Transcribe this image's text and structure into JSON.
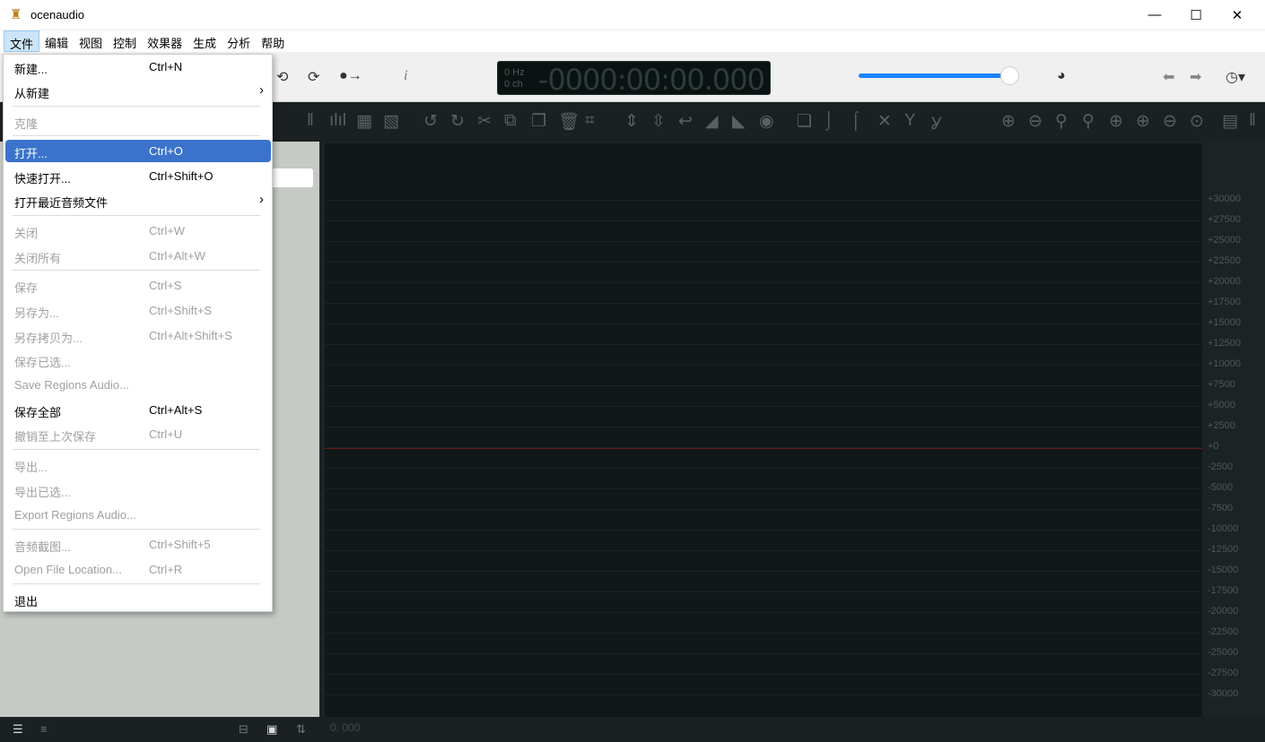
{
  "app": {
    "title": "ocenaudio",
    "icon": "ocenaudio-logo-icon"
  },
  "window_controls": [
    "minimize",
    "maximize",
    "close"
  ],
  "menubar": [
    "文件",
    "编辑",
    "视图",
    "控制",
    "效果器",
    "生成",
    "分析",
    "帮助"
  ],
  "display": {
    "rate": "0 Hz",
    "channels": "0 ch",
    "time": "-0000:00:00.000"
  },
  "volume": {
    "level_percent": 100,
    "color": "#1a84ff"
  },
  "file_menu": [
    {
      "label": "新建...",
      "shortcut": "Ctrl+N",
      "disabled": false
    },
    {
      "label": "从新建",
      "shortcut": "",
      "submenu": true,
      "disabled": false
    },
    {
      "label": "克隆",
      "shortcut": "",
      "disabled": true,
      "sep": true
    },
    {
      "label": "打开...",
      "shortcut": "Ctrl+O",
      "disabled": false,
      "highlighted": true,
      "sep": true
    },
    {
      "label": "快速打开...",
      "shortcut": "Ctrl+Shift+O",
      "disabled": false
    },
    {
      "label": "打开最近音频文件",
      "shortcut": "",
      "submenu": true,
      "disabled": false
    },
    {
      "label": "关闭",
      "shortcut": "Ctrl+W",
      "disabled": true,
      "sep": true
    },
    {
      "label": "关闭所有",
      "shortcut": "Ctrl+Alt+W",
      "disabled": true
    },
    {
      "label": "保存",
      "shortcut": "Ctrl+S",
      "disabled": true,
      "sep": true
    },
    {
      "label": "另存为...",
      "shortcut": "Ctrl+Shift+S",
      "disabled": true
    },
    {
      "label": "另存拷贝为...",
      "shortcut": "Ctrl+Alt+Shift+S",
      "disabled": true
    },
    {
      "label": "保存已选...",
      "shortcut": "",
      "disabled": true
    },
    {
      "label": "Save Regions Audio...",
      "shortcut": "",
      "disabled": true
    },
    {
      "label": "保存全部",
      "shortcut": "Ctrl+Alt+S",
      "disabled": false
    },
    {
      "label": "撤销至上次保存",
      "shortcut": "Ctrl+U",
      "disabled": true
    },
    {
      "label": "导出...",
      "shortcut": "",
      "disabled": true,
      "sep": true
    },
    {
      "label": "导出已选...",
      "shortcut": "",
      "disabled": true
    },
    {
      "label": "Export Regions Audio...",
      "shortcut": "",
      "disabled": true
    },
    {
      "label": "音频截图...",
      "shortcut": "Ctrl+Shift+5",
      "disabled": true,
      "sep": true
    },
    {
      "label": "Open File Location...",
      "shortcut": "Ctrl+R",
      "disabled": true
    },
    {
      "label": "退出",
      "shortcut": "",
      "disabled": false,
      "sep": true
    }
  ],
  "y_axis": [
    "+30000",
    "+27500",
    "+25000",
    "+22500",
    "+20000",
    "+17500",
    "+15000",
    "+12500",
    "+10000",
    "+7500",
    "+5000",
    "+2500",
    "+0",
    "-2500",
    "-5000",
    "-7500",
    "-10000",
    "-12500",
    "-15000",
    "-17500",
    "-20000",
    "-22500",
    "-25000",
    "-27500",
    "-30000"
  ],
  "position_readout": "0. 000",
  "colors": {
    "highlight": "#3b73cc",
    "zero_line": "#6a1a1a"
  }
}
